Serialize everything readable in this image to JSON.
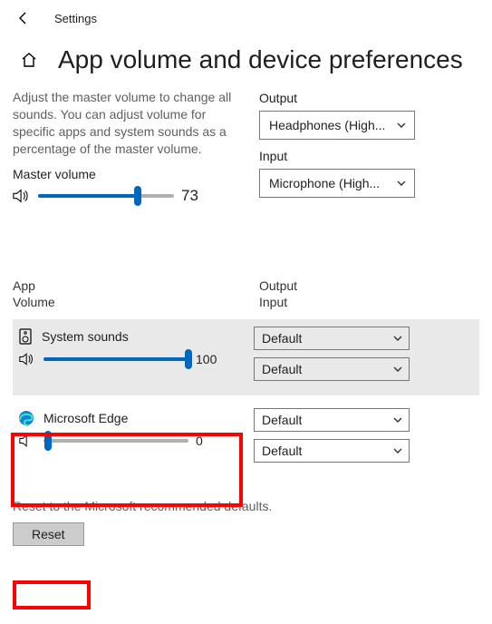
{
  "titlebar": {
    "title": "Settings"
  },
  "header": {
    "page_title": "App volume and device preferences"
  },
  "description": "Adjust the master volume to change all sounds. You can adjust volume for specific apps and system sounds as a percentage of the master volume.",
  "master": {
    "label": "Master volume",
    "value": "73"
  },
  "output": {
    "label": "Output",
    "selected": "Headphones (High..."
  },
  "input": {
    "label": "Input",
    "selected": "Microphone (High..."
  },
  "columns": {
    "app": "App",
    "volume": "Volume",
    "output": "Output",
    "input": "Input"
  },
  "apps": {
    "system": {
      "name": "System sounds",
      "volume": "100",
      "output": "Default",
      "input": "Default"
    },
    "edge": {
      "name": "Microsoft Edge",
      "volume": "0",
      "output": "Default",
      "input": "Default"
    }
  },
  "reset": {
    "desc": "Reset to the Microsoft recommended defaults.",
    "button": "Reset"
  }
}
